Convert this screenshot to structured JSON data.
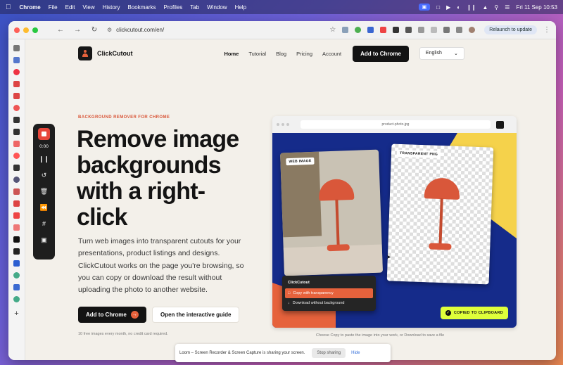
{
  "menubar": {
    "app": "Chrome",
    "items": [
      "File",
      "Edit",
      "View",
      "History",
      "Bookmarks",
      "Profiles",
      "Tab",
      "Window",
      "Help"
    ],
    "clock": "Fri 11 Sep  10:53"
  },
  "browser": {
    "url": "clickcutout.com/en/",
    "relaunch_label": "Relaunch to update"
  },
  "site": {
    "brand": "ClickCutout",
    "nav": [
      "Home",
      "Tutorial",
      "Blog",
      "Pricing",
      "Account"
    ],
    "nav_cta": "Add to Chrome",
    "language": "English"
  },
  "hero": {
    "eyebrow": "BACKGROUND REMOVER FOR CHROME",
    "headline": "Remove image backgrounds with a right-click",
    "body": "Turn web images into transparent cutouts for your presentations, product listings and designs. ClickCutout works on the page you're browsing, so you can copy or download the result without uploading the photo to another website.",
    "primary_cta": "Add to Chrome",
    "secondary_cta": "Open the interactive guide",
    "fineprint": "10 free images every month, no credit card required."
  },
  "mock": {
    "url": "product-photo.jpg",
    "tag_web": "WEB IMAGE",
    "tag_png": "TRANSPARENT PNG",
    "menu_title": "ClickCutout",
    "menu_copy": "Copy with transparency",
    "menu_download": "Download without background",
    "copied_badge": "COPIED TO CLIPBOARD",
    "caption": "Choose Copy to paste the image into your work, or Download to save a file"
  },
  "loom": {
    "timer": "0:00"
  },
  "sharebar": {
    "message": "Loom – Screen Recorder & Screen Capture is sharing your screen.",
    "stop_label": "Stop sharing",
    "hide_label": "Hide"
  },
  "colors": {
    "accent": "#e6623c",
    "dark": "#131313",
    "page_bg": "#f3f0ea"
  }
}
